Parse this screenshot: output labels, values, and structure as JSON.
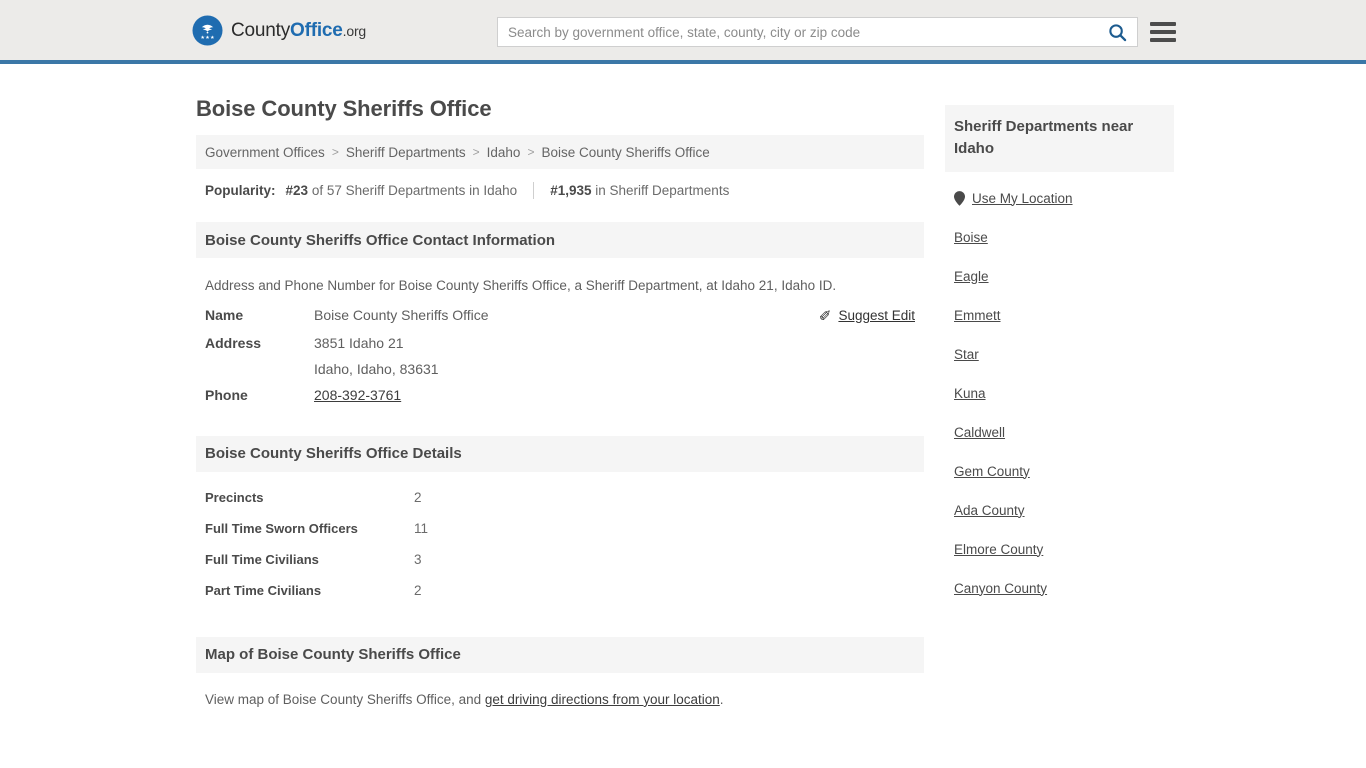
{
  "header": {
    "brand": {
      "part1": "County",
      "part2": "Office",
      "part3": ".org",
      "logo_icon": "eagle-seal-icon"
    },
    "search": {
      "placeholder": "Search by government office, state, county, city or zip code",
      "value": "",
      "icon": "search-icon"
    },
    "menu_icon": "hamburger-menu-icon",
    "accent_color": "#3b77a7",
    "background_color": "#ecebe9"
  },
  "page": {
    "title": "Boise County Sheriffs Office"
  },
  "breadcrumb": {
    "separator": ">",
    "items": [
      {
        "label": "Government Offices"
      },
      {
        "label": "Sheriff Departments"
      },
      {
        "label": "Idaho"
      },
      {
        "label": "Boise County Sheriffs Office"
      }
    ]
  },
  "popularity": {
    "label": "Popularity:",
    "rank_local": "#23",
    "rank_local_suffix": "of 57 Sheriff Departments in Idaho",
    "rank_global": "#1,935",
    "rank_global_suffix": "in Sheriff Departments"
  },
  "contact_section": {
    "heading": "Boise County Sheriffs Office Contact Information",
    "description": "Address and Phone Number for Boise County Sheriffs Office, a Sheriff Department, at Idaho 21, Idaho ID.",
    "rows": {
      "name_label": "Name",
      "name_value": "Boise County Sheriffs Office",
      "address_label": "Address",
      "address_line1": "3851 Idaho 21",
      "address_line2": "Idaho, Idaho, 83631",
      "phone_label": "Phone",
      "phone_value": "208-392-3761"
    },
    "suggest_edit": {
      "label": "Suggest Edit",
      "icon": "pencil-edit-icon",
      "glyph": "✐"
    }
  },
  "details_section": {
    "heading": "Boise County Sheriffs Office Details",
    "rows": [
      {
        "label": "Precincts",
        "value": "2"
      },
      {
        "label": "Full Time Sworn Officers",
        "value": "11"
      },
      {
        "label": "Full Time Civilians",
        "value": "3"
      },
      {
        "label": "Part Time Civilians",
        "value": "2"
      }
    ]
  },
  "map_section": {
    "heading": "Map of Boise County Sheriffs Office",
    "text_before": "View map of Boise County Sheriffs Office, and ",
    "link_text": "get driving directions from your location",
    "text_after": "."
  },
  "sidebar": {
    "heading": "Sheriff Departments near Idaho",
    "use_my_location": {
      "label": "Use My Location",
      "icon": "map-pin-icon"
    },
    "links": [
      {
        "label": "Boise"
      },
      {
        "label": "Eagle"
      },
      {
        "label": "Emmett"
      },
      {
        "label": "Star"
      },
      {
        "label": "Kuna"
      },
      {
        "label": "Caldwell"
      },
      {
        "label": "Gem County"
      },
      {
        "label": "Ada County"
      },
      {
        "label": "Elmore County"
      },
      {
        "label": "Canyon County"
      }
    ]
  }
}
